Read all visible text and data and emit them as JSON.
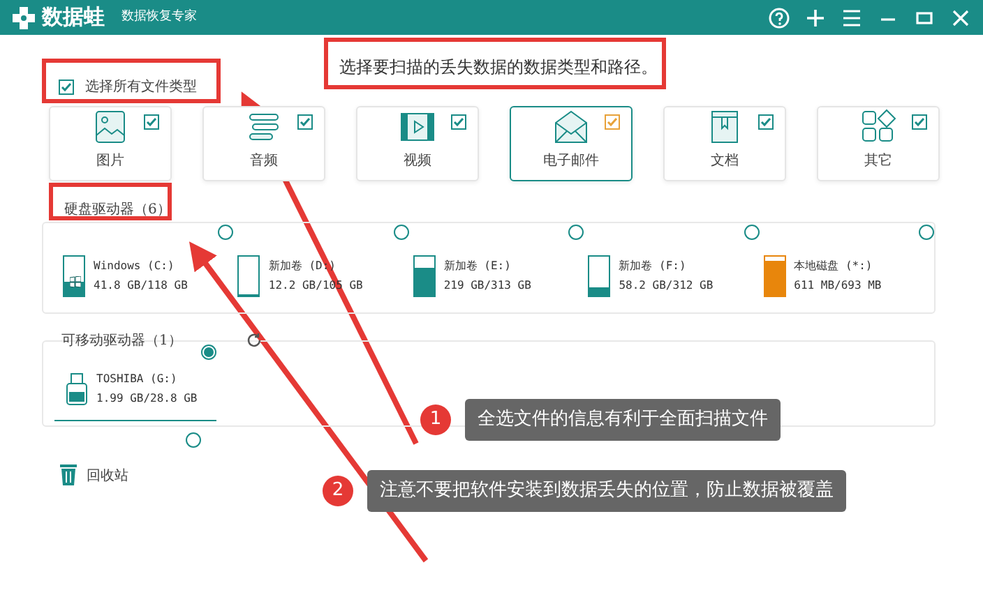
{
  "app": {
    "name": "数据蛙",
    "subtitle": "数据恢复专家"
  },
  "select_all": {
    "label": "选择所有文件类型",
    "checked": true
  },
  "instruction": "选择要扫描的丢失数据的数据类型和路径。",
  "categories": [
    {
      "kind": "image",
      "label": "图片",
      "checked": true,
      "selected": false
    },
    {
      "kind": "audio",
      "label": "音频",
      "checked": true,
      "selected": false
    },
    {
      "kind": "video",
      "label": "视频",
      "checked": true,
      "selected": false
    },
    {
      "kind": "email",
      "label": "电子邮件",
      "checked": true,
      "selected": true
    },
    {
      "kind": "document",
      "label": "文档",
      "checked": true,
      "selected": false
    },
    {
      "kind": "other",
      "label": "其它",
      "checked": true,
      "selected": false
    }
  ],
  "hard_drives": {
    "title": "硬盘驱动器（6）",
    "drives": [
      {
        "name": "Windows (C:)",
        "usage": "41.8 GB/118 GB",
        "level": 0.35,
        "color": "#1a8c87",
        "system": true,
        "selected": false
      },
      {
        "name": "新加卷 (D:)",
        "usage": "12.2 GB/105 GB",
        "level": 0.05,
        "color": "#1a8c87",
        "system": false,
        "selected": false
      },
      {
        "name": "新加卷 (E:)",
        "usage": "219 GB/313 GB",
        "level": 0.7,
        "color": "#1a8c87",
        "system": false,
        "selected": false
      },
      {
        "name": "新加卷 (F:)",
        "usage": "58.2 GB/312 GB",
        "level": 0.2,
        "color": "#1a8c87",
        "system": false,
        "selected": false
      },
      {
        "name": "本地磁盘 (*:)",
        "usage": "611 MB/693 MB",
        "level": 0.9,
        "color": "#e8860c",
        "system": false,
        "selected": false
      }
    ]
  },
  "removable": {
    "title": "可移动驱动器（1）",
    "drives": [
      {
        "name": "TOSHIBA (G:)",
        "usage": "1.99 GB/28.8 GB",
        "selected": true
      }
    ]
  },
  "recycle_bin": {
    "label": "回收站",
    "selected": false
  },
  "callouts": [
    {
      "number": "1",
      "text": "全选文件的信息有利于全面扫描文件"
    },
    {
      "number": "2",
      "text": "注意不要把软件安装到数据丢失的位置，防止数据被覆盖"
    }
  ]
}
